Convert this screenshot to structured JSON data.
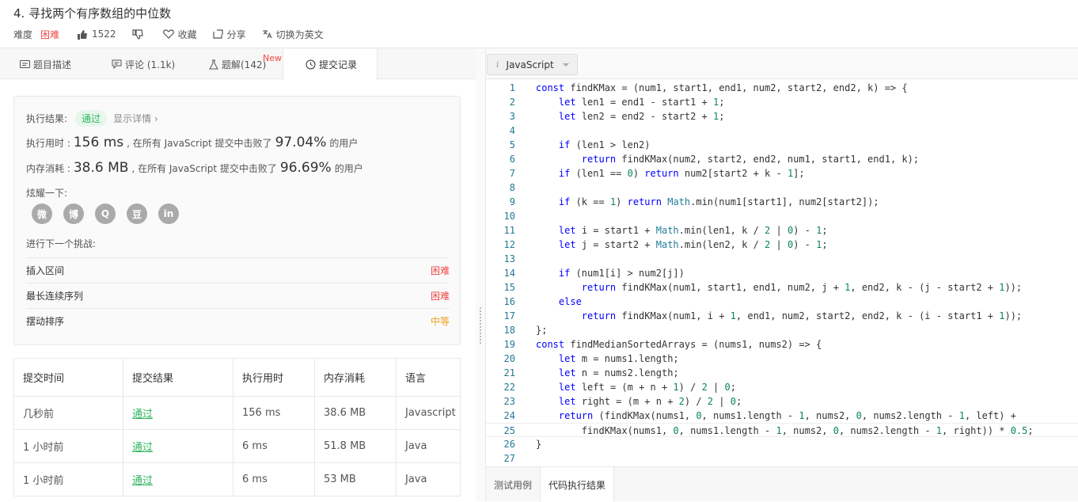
{
  "problem": {
    "title": "4. 寻找两个有序数组的中位数",
    "difficulty_label": "难度",
    "difficulty": "困难",
    "likes": "1522",
    "favorite_label": "收藏",
    "share_label": "分享",
    "switch_lang_label": "切换为英文"
  },
  "tabs": [
    {
      "label": "题目描述"
    },
    {
      "label": "评论 (1.1k)"
    },
    {
      "label": "题解(142)",
      "badge": "New"
    },
    {
      "label": "提交记录"
    }
  ],
  "result": {
    "status_label": "执行结果:",
    "status": "通过",
    "detail_link": "显示详情 ›",
    "time_label": "执行用时 :",
    "time_value": "156 ms",
    "time_mid": ", 在所有 JavaScript 提交中击败了",
    "time_pct": "97.04%",
    "time_tail": "的用户",
    "mem_label": "内存消耗 :",
    "mem_value": "38.6 MB",
    "mem_mid": ", 在所有 JavaScript 提交中击败了",
    "mem_pct": "96.69%",
    "mem_tail": "的用户",
    "share_label": "炫耀一下:",
    "share_icons": [
      "wechat-icon",
      "weibo-icon",
      "qq-icon",
      "douban-icon",
      "linkedin-icon"
    ],
    "share_glyphs": [
      "微",
      "博",
      "Q",
      "豆",
      "in"
    ],
    "next_label": "进行下一个挑战:",
    "challenges": [
      {
        "name": "插入区间",
        "level": "困难",
        "tone": "hard"
      },
      {
        "name": "最长连续序列",
        "level": "困难",
        "tone": "hard"
      },
      {
        "name": "摆动排序",
        "level": "中等",
        "tone": "medium"
      }
    ]
  },
  "submissions": {
    "headers": [
      "提交时间",
      "提交结果",
      "执行用时",
      "内存消耗",
      "语言"
    ],
    "rows": [
      [
        "几秒前",
        "通过",
        "156 ms",
        "38.6 MB",
        "Javascript"
      ],
      [
        "1 小时前",
        "通过",
        "6 ms",
        "51.8 MB",
        "Java"
      ],
      [
        "1 小时前",
        "通过",
        "6 ms",
        "53 MB",
        "Java"
      ]
    ]
  },
  "editor": {
    "language": "JavaScript",
    "current_line": 25,
    "lines": [
      "const findKMax = (num1, start1, end1, num2, start2, end2, k) => {",
      "    let len1 = end1 - start1 + 1;",
      "    let len2 = end2 - start2 + 1;",
      "",
      "    if (len1 > len2)",
      "        return findKMax(num2, start2, end2, num1, start1, end1, k);",
      "    if (len1 == 0) return num2[start2 + k - 1];",
      "",
      "    if (k == 1) return Math.min(num1[start1], num2[start2]);",
      "",
      "    let i = start1 + Math.min(len1, k / 2 | 0) - 1;",
      "    let j = start2 + Math.min(len2, k / 2 | 0) - 1;",
      "",
      "    if (num1[i] > num2[j])",
      "        return findKMax(num1, start1, end1, num2, j + 1, end2, k - (j - start2 + 1));",
      "    else",
      "        return findKMax(num1, i + 1, end1, num2, start2, end2, k - (i - start1 + 1));",
      "};",
      "const findMedianSortedArrays = (nums1, nums2) => {",
      "    let m = nums1.length;",
      "    let n = nums2.length;",
      "    let left = (m + n + 1) / 2 | 0;",
      "    let right = (m + n + 2) / 2 | 0;",
      "    return (findKMax(nums1, 0, nums1.length - 1, nums2, 0, nums2.length - 1, left) +",
      "        findKMax(nums1, 0, nums1.length - 1, nums2, 0, nums2.length - 1, right)) * 0.5;",
      "}",
      ""
    ],
    "bottom_tabs": [
      "测试用例",
      "代码执行结果"
    ]
  }
}
